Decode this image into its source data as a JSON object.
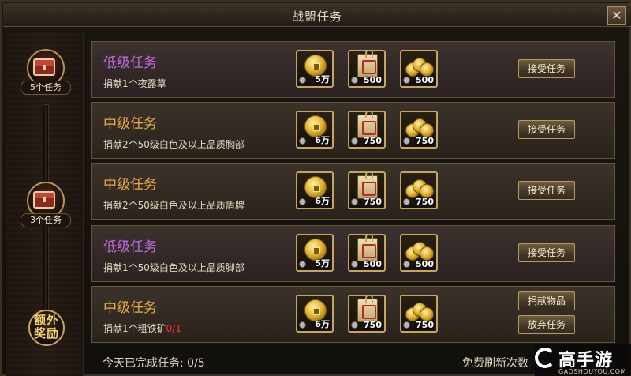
{
  "window": {
    "title": "战盟任务",
    "close_label": "✕"
  },
  "rail": {
    "chests": [
      {
        "label": "5个任务"
      },
      {
        "label": "3个任务"
      }
    ],
    "bonus_label": "额外奖励"
  },
  "tasks": [
    {
      "tier": "低级任务",
      "tier_color": "#c06be0",
      "desc": "捐献1个夜露草",
      "progress": "",
      "rewards": [
        {
          "icon": "gold-coin-icon",
          "qty": "5万"
        },
        {
          "icon": "guild-token-icon",
          "qty": "500"
        },
        {
          "icon": "coin-pile-icon",
          "qty": "500"
        }
      ],
      "buttons": [
        "接受任务"
      ]
    },
    {
      "tier": "中级任务",
      "tier_color": "#e8a94a",
      "desc": "捐献2个50级白色及以上品质胸部",
      "progress": "",
      "rewards": [
        {
          "icon": "gold-coin-icon",
          "qty": "6万"
        },
        {
          "icon": "guild-token-icon",
          "qty": "750"
        },
        {
          "icon": "coin-pile-icon",
          "qty": "750"
        }
      ],
      "buttons": [
        "接受任务"
      ]
    },
    {
      "tier": "中级任务",
      "tier_color": "#e8a94a",
      "desc": "捐献2个50级白色及以上品质盾牌",
      "progress": "",
      "rewards": [
        {
          "icon": "gold-coin-icon",
          "qty": "6万"
        },
        {
          "icon": "guild-token-icon",
          "qty": "750"
        },
        {
          "icon": "coin-pile-icon",
          "qty": "750"
        }
      ],
      "buttons": [
        "接受任务"
      ]
    },
    {
      "tier": "低级任务",
      "tier_color": "#c06be0",
      "desc": "捐献1个50级白色及以上品质脚部",
      "progress": "",
      "rewards": [
        {
          "icon": "gold-coin-icon",
          "qty": "5万"
        },
        {
          "icon": "guild-token-icon",
          "qty": "500"
        },
        {
          "icon": "coin-pile-icon",
          "qty": "500"
        }
      ],
      "buttons": [
        "接受任务"
      ]
    },
    {
      "tier": "中级任务",
      "tier_color": "#e8a94a",
      "desc": "捐献1个粗铁矿",
      "progress": "0/1",
      "rewards": [
        {
          "icon": "gold-coin-icon",
          "qty": "6万"
        },
        {
          "icon": "guild-token-icon",
          "qty": "750"
        },
        {
          "icon": "coin-pile-icon",
          "qty": "750"
        }
      ],
      "buttons": [
        "捐献物品",
        "放弃任务"
      ]
    }
  ],
  "footer": {
    "completed_label": "今天已完成任务:  0/5",
    "refresh_label": "免费刷新次数"
  },
  "watermark": {
    "brand": "高手游",
    "domain": "GAOSHOUYOU.COM"
  }
}
